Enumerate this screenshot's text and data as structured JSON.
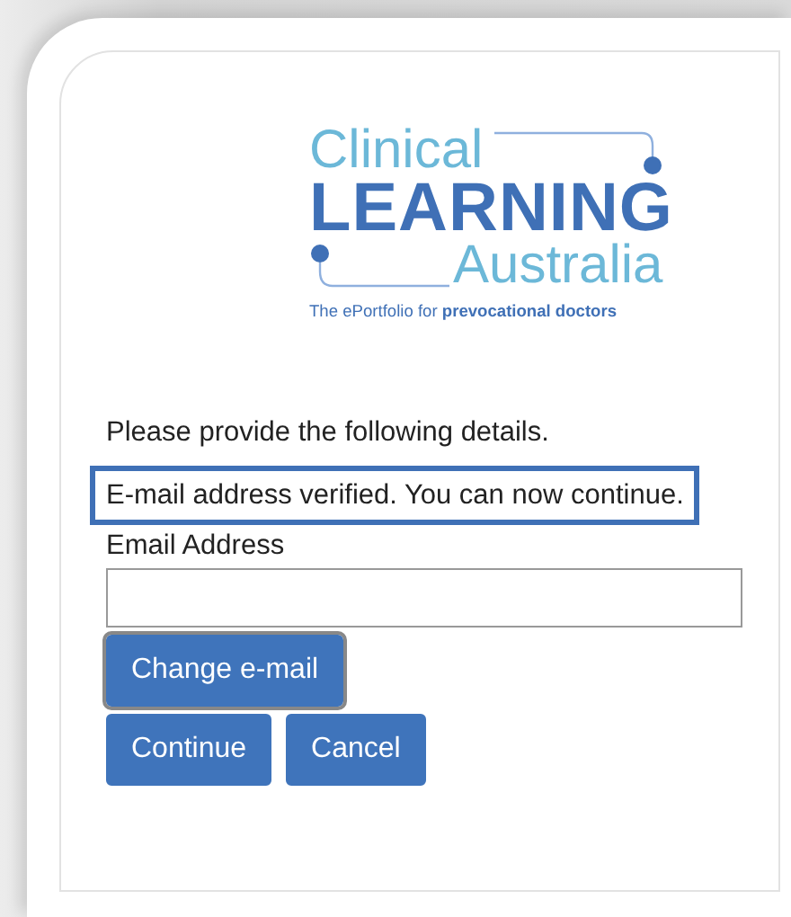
{
  "logo": {
    "line_1": "Clinical",
    "line_2": "LEARNING",
    "line_3": "Australia",
    "tagline": "The ePortfolio for **prevocational doctors**"
  },
  "form": {
    "intro": "Please provide the following details.",
    "message": {
      "text": "E-mail address verified. You can now continue.",
      "highlighted": true
    },
    "email_label": "Email Address",
    "buttons": [
      {
        "label": "Change e-mail",
        "focused": true
      },
      {
        "label": "Continue",
        "focused": false
      },
      {
        "label": "Cancel",
        "focused": false
      }
    ]
  }
}
